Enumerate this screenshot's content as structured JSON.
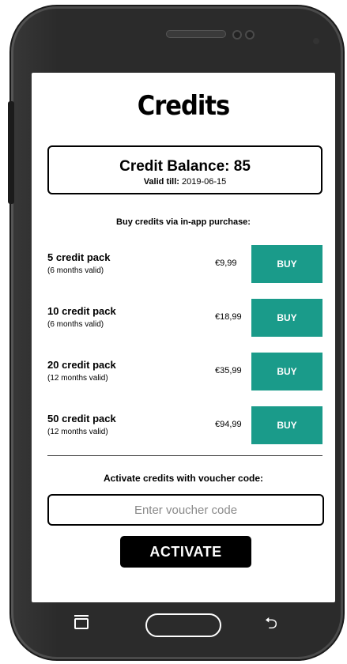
{
  "screen": {
    "title": "Credits",
    "balance": {
      "label": "Credit Balance: 85",
      "valid_label": "Valid till:",
      "valid_date": "2019-06-15"
    },
    "buy_heading": "Buy credits via in-app purchase:",
    "packs": [
      {
        "name": "5 credit pack",
        "validity": "(6 months valid)",
        "price": "€9,99",
        "button": "BUY"
      },
      {
        "name": "10 credit pack",
        "validity": "(6 months valid)",
        "price": "€18,99",
        "button": "BUY"
      },
      {
        "name": "20 credit pack",
        "validity": "(12 months valid)",
        "price": "€35,99",
        "button": "BUY"
      },
      {
        "name": "50 credit pack",
        "validity": "(12 months valid)",
        "price": "€94,99",
        "button": "BUY"
      }
    ],
    "voucher": {
      "heading": "Activate credits with voucher code:",
      "placeholder": "Enter voucher code",
      "value": ""
    },
    "activate_button": "ACTIVATE"
  },
  "colors": {
    "accent": "#1a9b8a",
    "phone_body": "#2b2b2b",
    "button_dark": "#000000"
  },
  "icons": {
    "recent": "recent-apps-icon",
    "home": "home-button",
    "back": "back-icon"
  }
}
